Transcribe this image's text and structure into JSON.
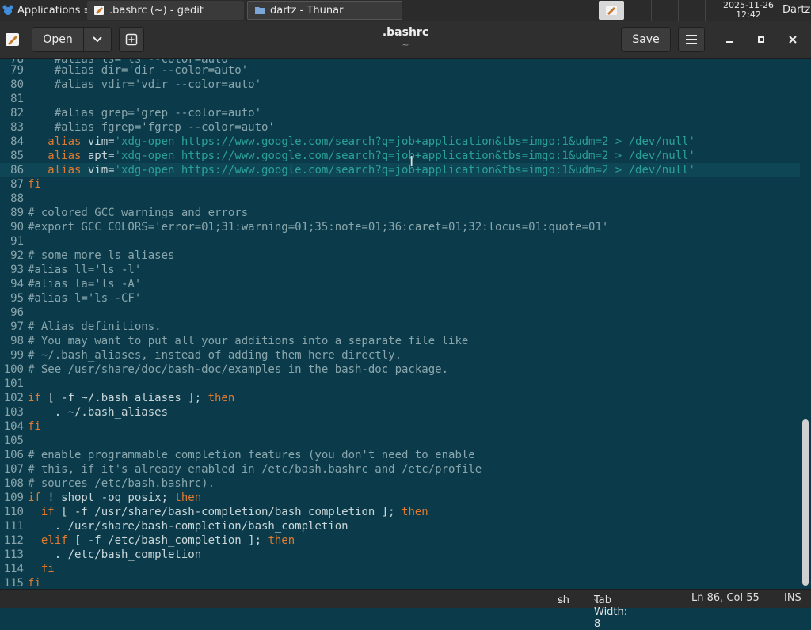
{
  "panel": {
    "applications_label": "Applications",
    "tasks": [
      {
        "label": ".bashrc (~) - gedit",
        "icon": "gedit-icon"
      },
      {
        "label": "dartz - Thunar",
        "icon": "folder-icon"
      }
    ],
    "clock_date": "2025-11-26",
    "clock_time": "12:42",
    "user": "Dartz"
  },
  "header": {
    "open_label": "Open",
    "title": ".bashrc",
    "subtitle": "~",
    "save_label": "Save"
  },
  "editor": {
    "current_line": 86,
    "lines": [
      {
        "n": "79",
        "t": "    #alias dir='dir --color=auto'"
      },
      {
        "n": "80",
        "t": "    #alias vdir='vdir --color=auto'"
      },
      {
        "n": "81",
        "t": ""
      },
      {
        "n": "82",
        "t": "    #alias grep='grep --color=auto'"
      },
      {
        "n": "83",
        "t": "    #alias fgrep='fgrep --color=auto'"
      },
      {
        "n": "84",
        "t": "   alias vim='xdg-open https://www.google.com/search?q=job+application&tbs=imgo:1&udm=2 > /dev/null'"
      },
      {
        "n": "85",
        "t": "   alias apt='xdg-open https://www.google.com/search?q=job+application&tbs=imgo:1&udm=2 > /dev/null'"
      },
      {
        "n": "86",
        "t": "   alias vim='xdg-open https://www.google.com/search?q=job+application&tbs=imgo:1&udm=2 > /dev/null'"
      },
      {
        "n": "87",
        "t": "fi"
      },
      {
        "n": "88",
        "t": ""
      },
      {
        "n": "89",
        "t": "# colored GCC warnings and errors"
      },
      {
        "n": "90",
        "t": "#export GCC_COLORS='error=01;31:warning=01;35:note=01;36:caret=01;32:locus=01:quote=01'"
      },
      {
        "n": "91",
        "t": ""
      },
      {
        "n": "92",
        "t": "# some more ls aliases"
      },
      {
        "n": "93",
        "t": "#alias ll='ls -l'"
      },
      {
        "n": "94",
        "t": "#alias la='ls -A'"
      },
      {
        "n": "95",
        "t": "#alias l='ls -CF'"
      },
      {
        "n": "96",
        "t": ""
      },
      {
        "n": "97",
        "t": "# Alias definitions."
      },
      {
        "n": "98",
        "t": "# You may want to put all your additions into a separate file like"
      },
      {
        "n": "99",
        "t": "# ~/.bash_aliases, instead of adding them here directly."
      },
      {
        "n": "100",
        "t": "# See /usr/share/doc/bash-doc/examples in the bash-doc package."
      },
      {
        "n": "101",
        "t": ""
      },
      {
        "n": "102",
        "t": "if [ -f ~/.bash_aliases ]; then"
      },
      {
        "n": "103",
        "t": "    . ~/.bash_aliases"
      },
      {
        "n": "104",
        "t": "fi"
      },
      {
        "n": "105",
        "t": ""
      },
      {
        "n": "106",
        "t": "# enable programmable completion features (you don't need to enable"
      },
      {
        "n": "107",
        "t": "# this, if it's already enabled in /etc/bash.bashrc and /etc/profile"
      },
      {
        "n": "108",
        "t": "# sources /etc/bash.bashrc)."
      },
      {
        "n": "109",
        "t": "if ! shopt -oq posix; then"
      },
      {
        "n": "110",
        "t": "  if [ -f /usr/share/bash-completion/bash_completion ]; then"
      },
      {
        "n": "111",
        "t": "    . /usr/share/bash-completion/bash_completion"
      },
      {
        "n": "112",
        "t": "  elif [ -f /etc/bash_completion ]; then"
      },
      {
        "n": "113",
        "t": "    . /etc/bash_completion"
      },
      {
        "n": "114",
        "t": "  fi"
      },
      {
        "n": "115",
        "t": "fi"
      }
    ]
  },
  "statusbar": {
    "language": "sh",
    "tab_width": "Tab Width: 8",
    "position": "Ln 86, Col 55",
    "mode": "INS"
  },
  "colors": {
    "editor_bg": "#0b3b4a",
    "keyword": "#e07a2f",
    "string": "#2aa198",
    "comment": "#8aa6ad"
  }
}
